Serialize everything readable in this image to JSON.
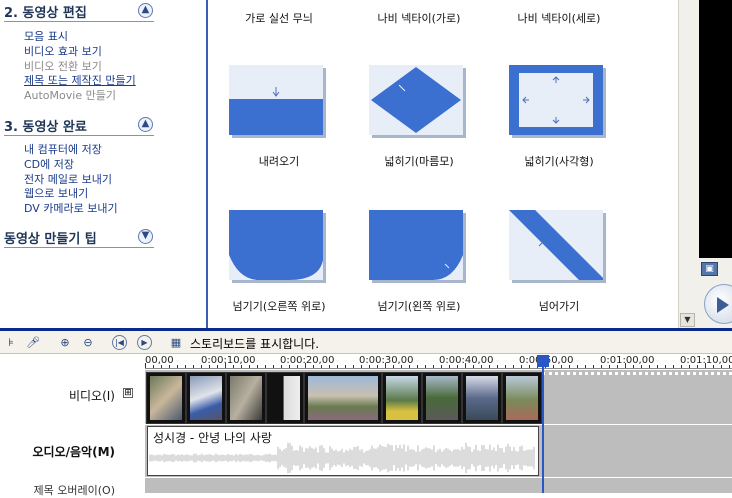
{
  "taskpane": {
    "section2": {
      "title": "2. 동영상 편집",
      "toggle": "▲",
      "items": [
        {
          "label": "모음 표시",
          "state": "enabled"
        },
        {
          "label": "비디오 효과 보기",
          "state": "enabled"
        },
        {
          "label": "비디오 전환 보기",
          "state": "disabled"
        },
        {
          "label": "제목 또는 제작진 만들기",
          "state": "selected"
        },
        {
          "label": "AutoMovie 만들기",
          "state": "disabled"
        }
      ]
    },
    "section3": {
      "title": "3. 동영상 완료",
      "toggle": "▲",
      "items": [
        {
          "label": "내 컴퓨터에 저장"
        },
        {
          "label": "CD에 저장"
        },
        {
          "label": "전자 메일로 보내기"
        },
        {
          "label": "웹으로 보내기"
        },
        {
          "label": "DV 카메라로 보내기"
        }
      ]
    },
    "tips": {
      "title": "동영상 만들기 팁",
      "toggle": "▼"
    }
  },
  "gallery": {
    "top_labels": [
      "가로 실선 무늬",
      "나비 넥타이(가로)",
      "나비 넥타이(세로)"
    ],
    "items": [
      {
        "label": "내려오기",
        "icon": "wipe-down-transition-icon"
      },
      {
        "label": "넓히기(마름모)",
        "icon": "diamond-expand-transition-icon"
      },
      {
        "label": "넓히기(사각형)",
        "icon": "rectangle-expand-transition-icon"
      },
      {
        "label": "넘기기(오른쪽 위로)",
        "icon": "page-curl-right-transition-icon"
      },
      {
        "label": "넘기기(왼쪽 위로)",
        "icon": "page-curl-left-transition-icon"
      },
      {
        "label": "넘어가기",
        "icon": "page-flip-transition-icon"
      }
    ]
  },
  "toolbar": {
    "storyboard_label": "스토리보드를 표시합니다."
  },
  "timeline": {
    "ruler_labels": [
      "00,00",
      "0:00:10,00",
      "0:00:20,00",
      "0:00:30,00",
      "0:00:40,00",
      "0:00:50,00",
      "0:01:00,00",
      "0:01:10,00"
    ],
    "video_label": "비디오(I)",
    "expand_symbol": "⊞",
    "audio_label": "오디오/음악(M)",
    "overlay_label": "제목 오버레이(O)",
    "audio_clip_title": "성시경 - 안녕 나의 사랑",
    "colors": {
      "accent": "#3b6fd0",
      "playhead": "#2a56c6",
      "track_bg": "#bdbdbd"
    }
  }
}
